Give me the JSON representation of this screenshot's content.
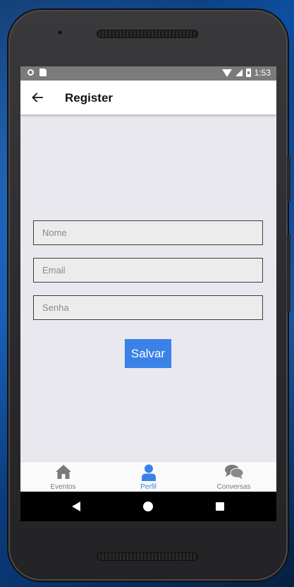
{
  "status_bar": {
    "time": "1:53"
  },
  "header": {
    "title": "Register"
  },
  "form": {
    "nome_placeholder": "Nome",
    "email_placeholder": "Email",
    "senha_placeholder": "Senha",
    "save_label": "Salvar"
  },
  "tabs": [
    {
      "label": "Eventos",
      "icon": "home-icon",
      "active": false
    },
    {
      "label": "Perfil",
      "icon": "user-icon",
      "active": true
    },
    {
      "label": "Conversas",
      "icon": "comments-icon",
      "active": false
    }
  ],
  "colors": {
    "accent": "#3b82e8",
    "inactive_tab": "#7a7a7a",
    "screen_background": "#e9e8ee",
    "status_bar": "#7b7b7b"
  }
}
